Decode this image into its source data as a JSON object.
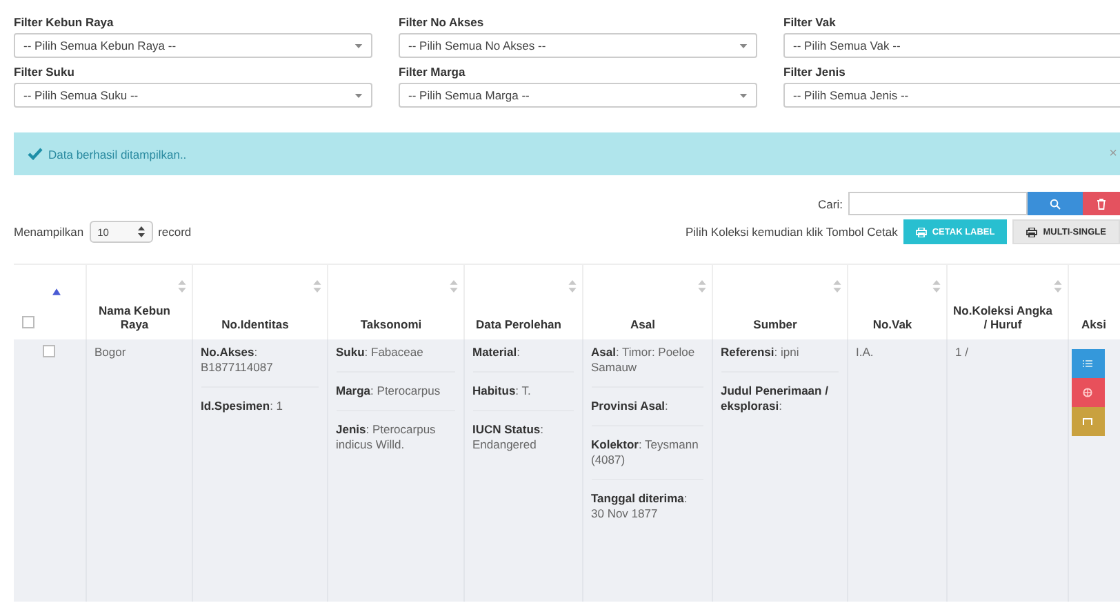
{
  "filters": [
    {
      "label": "Filter Kebun Raya",
      "placeholder": "-- Pilih Semua Kebun Raya --"
    },
    {
      "label": "Filter No Akses",
      "placeholder": "-- Pilih Semua No Akses --"
    },
    {
      "label": "Filter Vak",
      "placeholder": "-- Pilih Semua Vak --"
    },
    {
      "label": "Filter Suku",
      "placeholder": "-- Pilih Semua Suku --"
    },
    {
      "label": "Filter Marga",
      "placeholder": "-- Pilih Semua Marga --"
    },
    {
      "label": "Filter Jenis",
      "placeholder": "-- Pilih Semua Jenis --"
    }
  ],
  "alert": {
    "message": "Data berhasil ditampilkan..",
    "close": "×"
  },
  "search": {
    "label": "Cari:"
  },
  "length": {
    "prefix": "Menampilkan",
    "value": "10",
    "suffix": "record"
  },
  "print_hint": "Pilih Koleksi kemudian klik Tombol Cetak",
  "buttons": [
    {
      "kind": "print",
      "label": "CETAK LABEL"
    },
    {
      "kind": "secondary",
      "label": "MULTI-SINGLE"
    }
  ],
  "table": {
    "columns": [
      {
        "kind": "checkbox",
        "checked": false,
        "sorted": true
      },
      {
        "label": "Nama Kebun Raya",
        "sorted": false
      },
      {
        "label": "No.Identitas",
        "sorted": false
      },
      {
        "label": "Taksonomi",
        "sorted": false
      },
      {
        "label": "Data Perolehan",
        "sorted": false
      },
      {
        "label": "Asal",
        "sorted": false
      },
      {
        "label": "Sumber",
        "sorted": false
      },
      {
        "label": "No.Vak",
        "sorted": false
      },
      {
        "label": "No.Koleksi Angka / Huruf",
        "sorted": false
      },
      {
        "label": "Aksi"
      }
    ],
    "rows": [
      {
        "cells": [
          {
            "kind": "checkbox",
            "checked": false
          },
          {
            "kind": "fields",
            "fields": [
              "Bogor"
            ]
          },
          {
            "kind": "fields",
            "fields": [
              "**No.Akses**: B1877114087",
              "**Id.Spesimen**: 1"
            ]
          },
          {
            "kind": "fields",
            "fields": [
              "**Suku**: Fabaceae",
              "**Marga**: Pterocarpus",
              "**Jenis**: Pterocarpus indicus Willd."
            ]
          },
          {
            "kind": "fields",
            "fields": [
              "**Material**:",
              "**Habitus**: T.",
              "**IUCN Status**: Endangered"
            ]
          },
          {
            "kind": "fields",
            "fields": [
              "**Asal**: Timor: Poeloe Samauw",
              "**Provinsi Asal**:",
              "**Kolektor**: Teysmann (4087)",
              "**Tanggal diterima**: 30 Nov 1877"
            ]
          },
          {
            "kind": "fields",
            "fields": [
              "**Referensi**: ipni",
              "**Judul Penerimaan / eksplorasi**:"
            ]
          },
          {
            "kind": "fields",
            "fields": [
              "I.A."
            ]
          },
          {
            "kind": "fields",
            "fields": [
              "1 /"
            ]
          },
          {
            "kind": "actions",
            "actions": [
              {
                "kind": "detail"
              },
              {
                "kind": "print"
              },
              {
                "kind": "edit"
              }
            ]
          }
        ]
      }
    ]
  }
}
